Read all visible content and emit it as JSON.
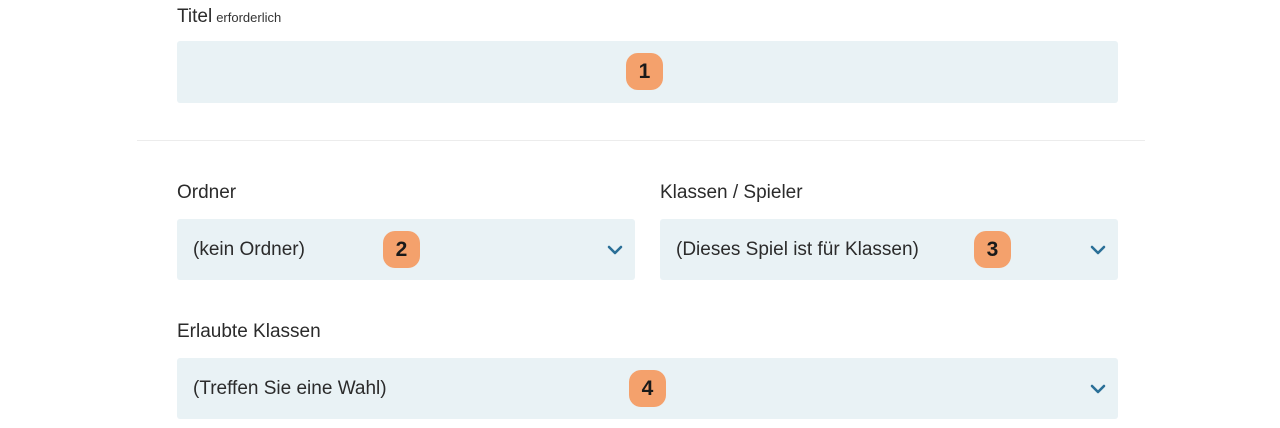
{
  "title_field": {
    "label": "Titel",
    "required_hint": "erforderlich",
    "value": "",
    "badge": "1"
  },
  "folder_field": {
    "label": "Ordner",
    "value": "(kein Ordner)",
    "badge": "2"
  },
  "players_field": {
    "label": "Klassen / Spieler",
    "value": "(Dieses Spiel ist für Klassen)",
    "badge": "3"
  },
  "classes_field": {
    "label": "Erlaubte Klassen",
    "value": "(Treffen Sie eine Wahl)",
    "badge": "4"
  },
  "icons": {
    "dropdown": "chevron-down-icon"
  },
  "colors": {
    "field_bg": "#e9f2f5",
    "badge_bg": "#f4a16c",
    "chevron": "#2a6f97"
  }
}
